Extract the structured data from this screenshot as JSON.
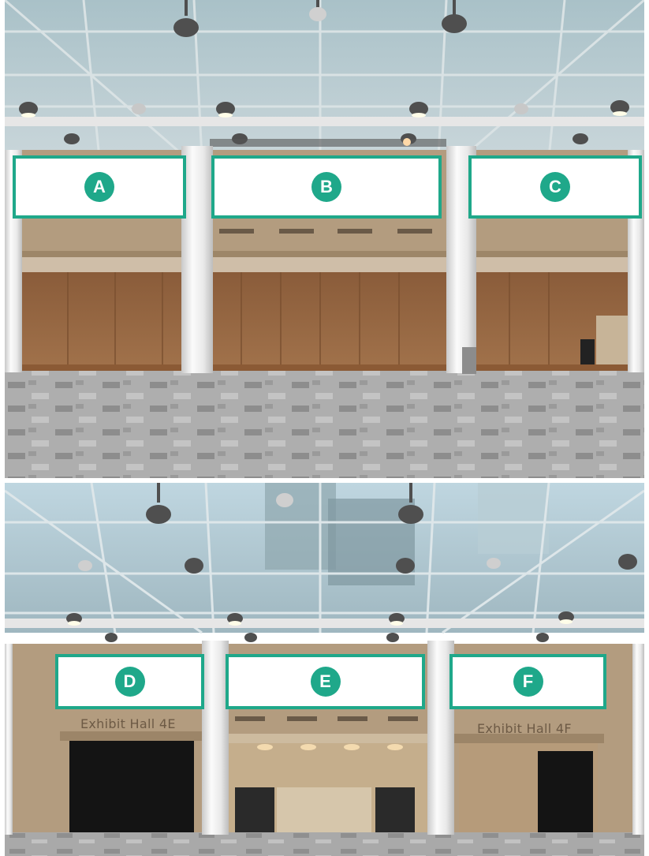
{
  "callouts": {
    "a": "A",
    "b": "B",
    "c": "C",
    "d": "D",
    "e": "E",
    "f": "F"
  },
  "hall_labels": {
    "hall_4e": "Exhibit Hall 4E",
    "hall_4f": "Exhibit Hall 4F"
  },
  "colors": {
    "accent": "#1fa88a",
    "wall": "#b39c7f",
    "pillar": "#f1f1f1",
    "carpet": "#a3a3a3"
  }
}
